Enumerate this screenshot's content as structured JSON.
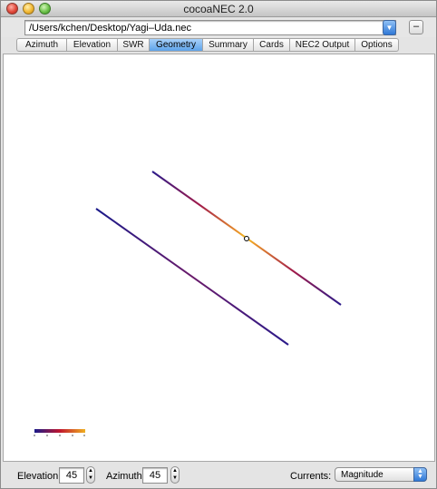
{
  "window": {
    "title": "cocoaNEC 2.0"
  },
  "toolbar": {
    "file_path": "/Users/kchen/Desktop/Yagi–Uda.nec",
    "minus_label": "–"
  },
  "tabs": [
    {
      "label": "Azimuth",
      "active": false
    },
    {
      "label": "Elevation",
      "active": false
    },
    {
      "label": "SWR",
      "active": false
    },
    {
      "label": "Geometry",
      "active": true
    },
    {
      "label": "Summary",
      "active": false
    },
    {
      "label": "Cards",
      "active": false
    },
    {
      "label": "NEC2 Output",
      "active": false
    },
    {
      "label": "Options",
      "active": false
    }
  ],
  "geometry_view": {
    "elements": [
      "reflector",
      "driven-element"
    ],
    "feed_point_marker": "circle",
    "current_colors": [
      "#1a1a8a",
      "#c0162e",
      "#f0b020"
    ]
  },
  "controls": {
    "elevation_label": "Elevation",
    "elevation_value": "45",
    "azimuth_label": "Azimuth",
    "azimuth_value": "45",
    "currents_label": "Currents:",
    "currents_value": "Magnitude"
  },
  "icons": {
    "close": "close-icon",
    "minimize": "minimize-icon",
    "zoom": "zoom-icon",
    "combo_arrow": "chevron-down-icon",
    "stepper": "stepper-arrows-icon",
    "popup_arrows": "up-down-arrows-icon"
  }
}
